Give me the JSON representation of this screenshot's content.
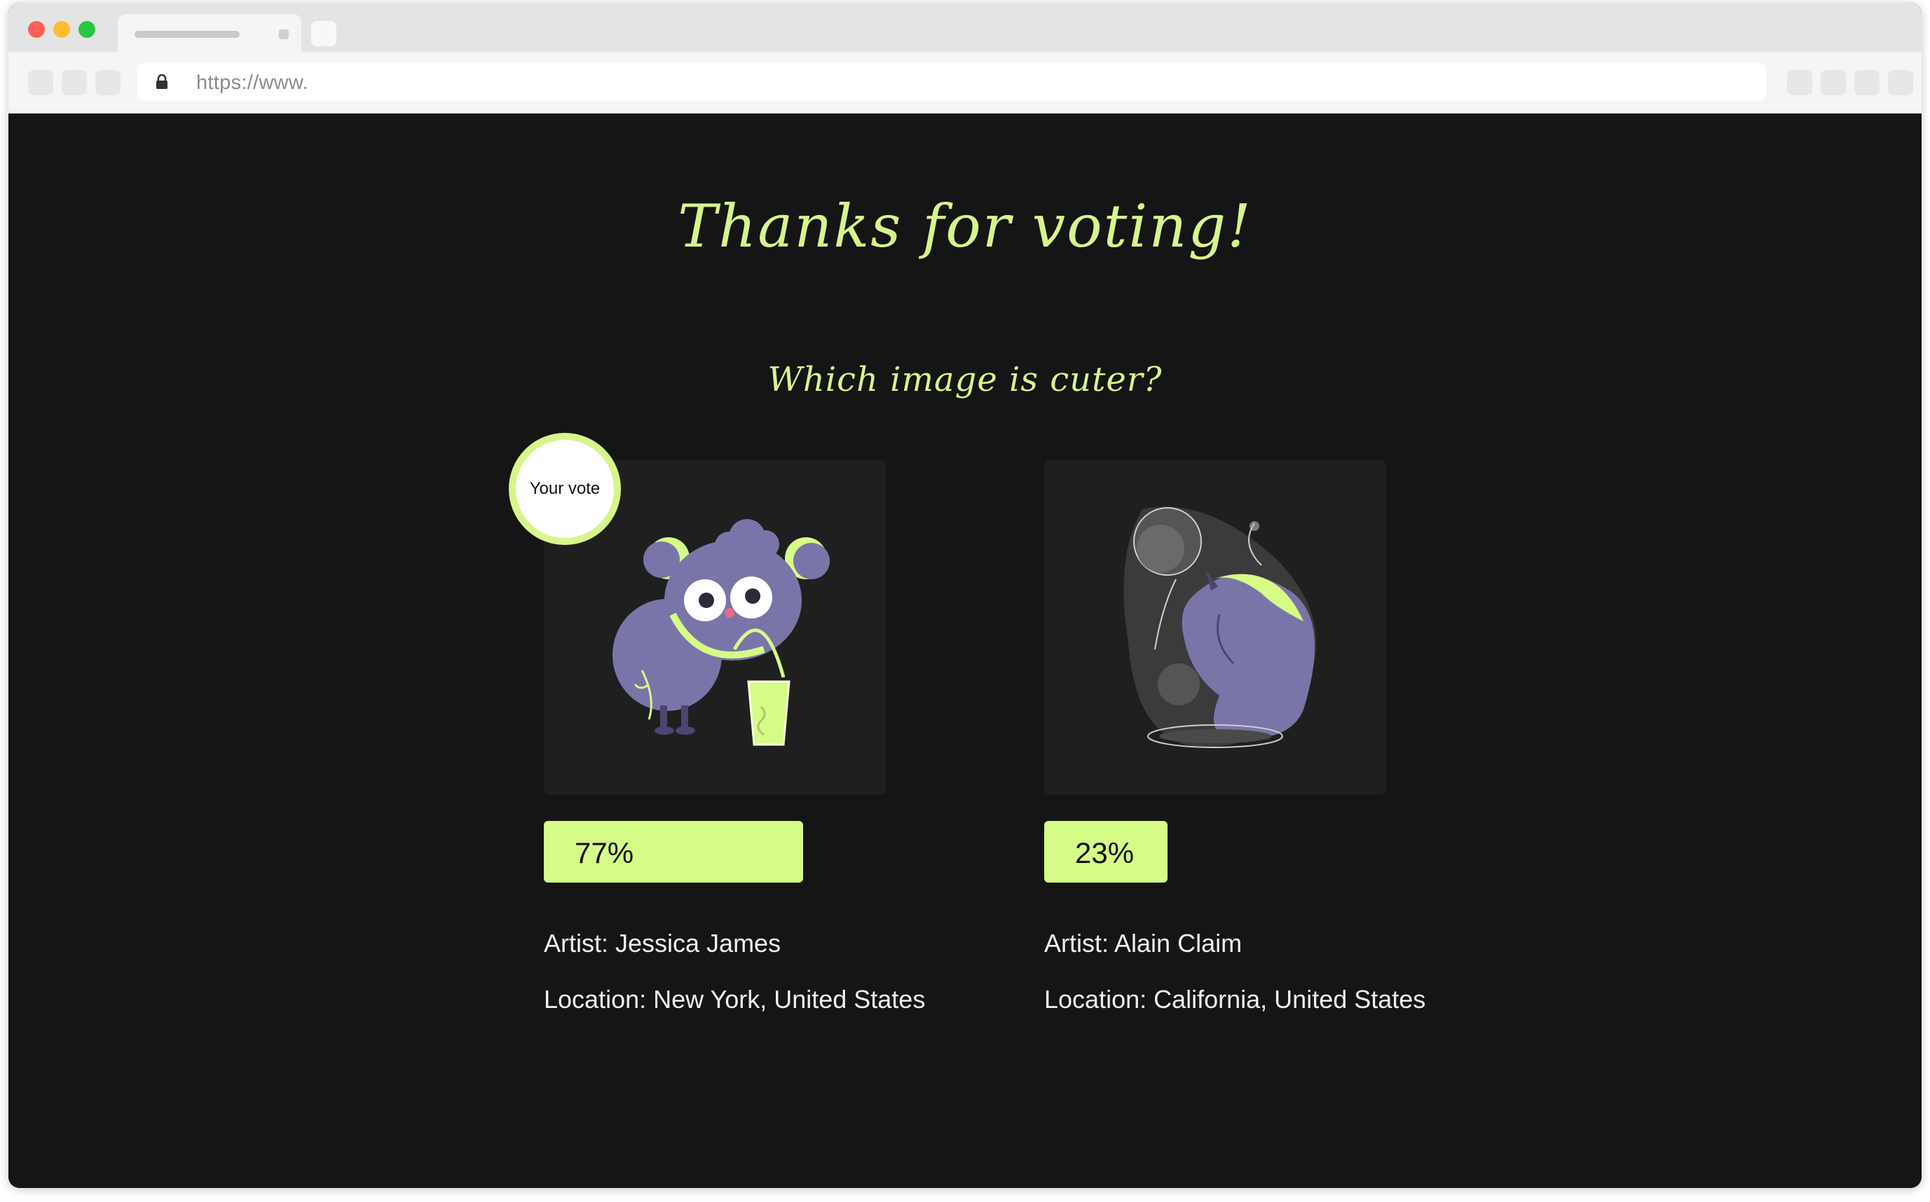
{
  "browser": {
    "url": "https://www."
  },
  "page": {
    "title": "Thanks for voting!",
    "question": "Which image is cuter?"
  },
  "options": [
    {
      "image_icon": "owl-drinking-juice-illustration",
      "vote_badge": "Your vote",
      "percent_label": "77%",
      "percent": 77,
      "artist": "Artist: Jessica James",
      "location": "Location: New York, United States"
    },
    {
      "image_icon": "horse-bust-illustration",
      "percent_label": "23%",
      "percent": 23,
      "artist": "Artist: Alain Claim",
      "location": "Location: California, United States"
    }
  ],
  "colors": {
    "accent": "#d6fb86",
    "background": "#151515",
    "card": "#1f1f1f",
    "illustration_purple": "#7a75a8"
  }
}
